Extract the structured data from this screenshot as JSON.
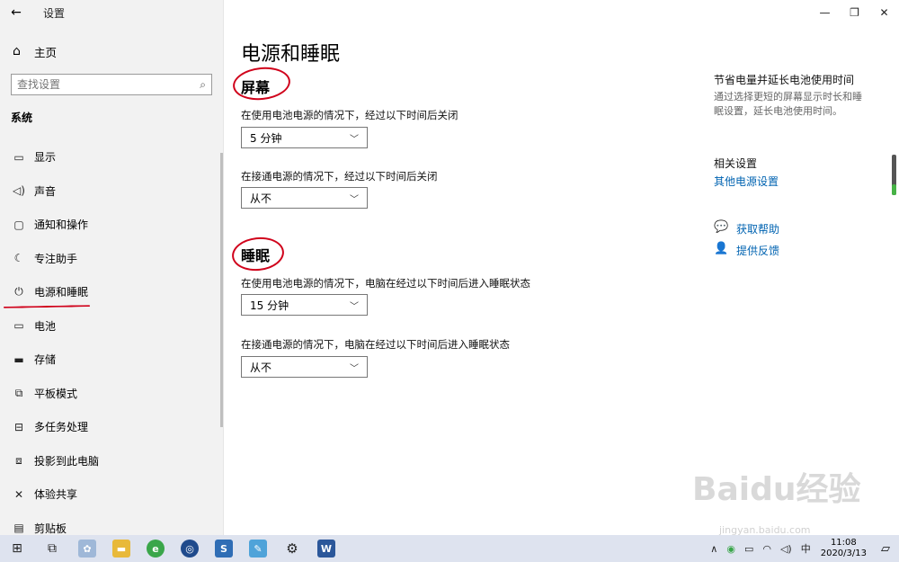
{
  "app": {
    "title": "设置"
  },
  "sidebar": {
    "home_label": "主页",
    "search_placeholder": "查找设置",
    "group_label": "系统",
    "items": [
      {
        "label": "显示",
        "icon": "monitor-icon"
      },
      {
        "label": "声音",
        "icon": "speaker-icon"
      },
      {
        "label": "通知和操作",
        "icon": "notification-icon"
      },
      {
        "label": "专注助手",
        "icon": "moon-icon"
      },
      {
        "label": "电源和睡眠",
        "icon": "power-icon",
        "selected": true
      },
      {
        "label": "电池",
        "icon": "battery-icon"
      },
      {
        "label": "存储",
        "icon": "storage-icon"
      },
      {
        "label": "平板模式",
        "icon": "tablet-icon"
      },
      {
        "label": "多任务处理",
        "icon": "multitask-icon"
      },
      {
        "label": "投影到此电脑",
        "icon": "project-icon"
      },
      {
        "label": "体验共享",
        "icon": "share-icon"
      },
      {
        "label": "剪贴板",
        "icon": "clipboard-icon"
      }
    ]
  },
  "main": {
    "page_title": "电源和睡眠",
    "screen": {
      "title": "屏幕",
      "battery_label": "在使用电池电源的情况下，经过以下时间后关闭",
      "battery_value": "5 分钟",
      "plugged_label": "在接通电源的情况下，经过以下时间后关闭",
      "plugged_value": "从不"
    },
    "sleep": {
      "title": "睡眠",
      "battery_label": "在使用电池电源的情况下，电脑在经过以下时间后进入睡眠状态",
      "battery_value": "15 分钟",
      "plugged_label": "在接通电源的情况下，电脑在经过以下时间后进入睡眠状态",
      "plugged_value": "从不"
    }
  },
  "right": {
    "tip_title": "节省电量并延长电池使用时间",
    "tip_text": "通过选择更短的屏幕显示时长和睡眠设置，延长电池使用时间。",
    "related_title": "相关设置",
    "related_link": "其他电源设置",
    "help_link": "获取帮助",
    "feedback_link": "提供反馈"
  },
  "taskbar": {
    "ime": "中",
    "time": "11:08",
    "date": "2020/3/13"
  },
  "watermark": {
    "text": "Baidu经验",
    "url_text": "jingyan.baidu.com"
  },
  "colors": {
    "accent": "#0063b1",
    "annotation": "#d0021b",
    "taskbar": "#dee3ef"
  }
}
